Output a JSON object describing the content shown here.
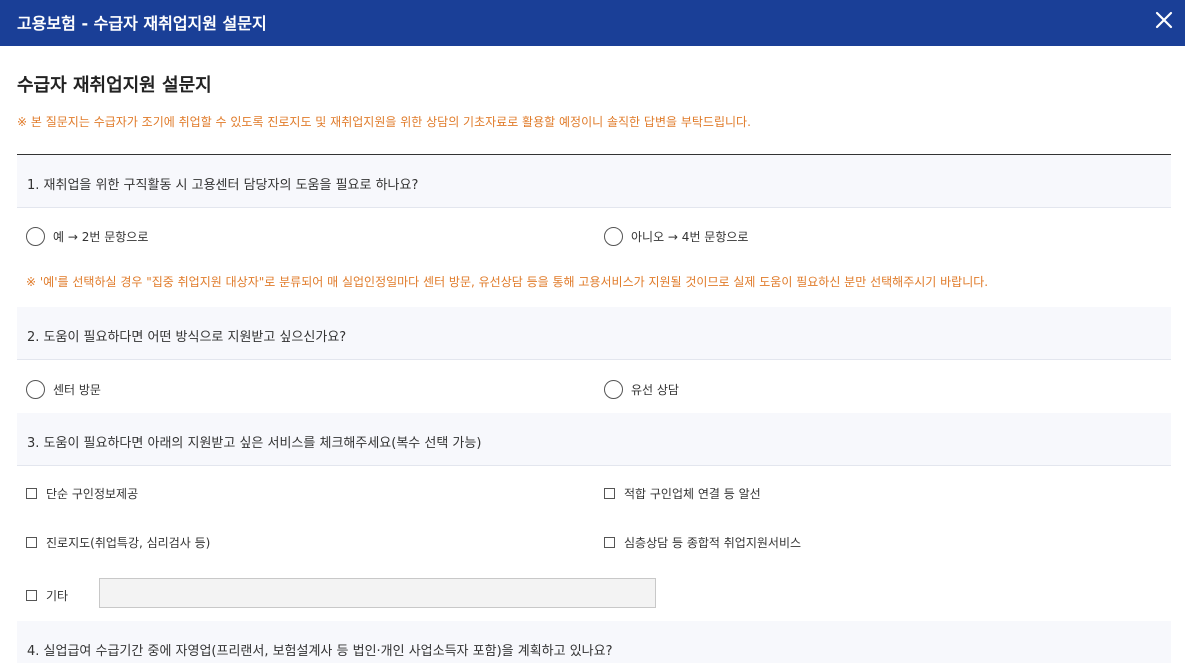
{
  "window": {
    "title": "고용보험 - 수급자 재취업지원 설문지",
    "close_icon": "close-icon"
  },
  "page": {
    "title": "수급자 재취업지원 설문지",
    "notice": "※ 본 질문지는 수급자가 조기에 취업할 수 있도록 진로지도 및 재취업지원을 위한 상담의 기초자료로 활용할 예정이니 솔직한 답변을 부탁드립니다."
  },
  "colors": {
    "header_bg": "#1a3f97",
    "notice_text": "#e07b2a",
    "question_bg": "#f7f8fc"
  },
  "questions": [
    {
      "text": "1. 재취업을 위한 구직활동 시 고용센터 담당자의 도움을 필요로 하나요?",
      "options": [
        "예 → 2번 문항으로",
        "아니오 → 4번 문항으로"
      ],
      "note": "※ '예'를 선택하실 경우 \"집중 취업지원 대상자\"로 분류되어 매 실업인정일마다 센터 방문, 유선상담 등을 통해 고용서비스가 지원될 것이므로 실제 도움이 필요하신 분만 선택해주시기 바랍니다."
    },
    {
      "text": "2. 도움이 필요하다면 어떤 방식으로 지원받고 싶으신가요?",
      "options": [
        "센터 방문",
        "유선 상담"
      ]
    },
    {
      "text": "3. 도움이 필요하다면 아래의 지원받고 싶은 서비스를 체크해주세요(복수 선택 가능)",
      "options": [
        "단순 구인정보제공",
        "적합 구인업체 연결 등 알선",
        "진로지도(취업특강, 심리검사 등)",
        "심층상담 등 종합적 취업지원서비스",
        "기타"
      ],
      "other_value": ""
    },
    {
      "text": "4. 실업급여 수급기간 중에 자영업(프리랜서, 보험설계사 등 법인·개인 사업소득자 포함)을 계획하고 있나요?"
    }
  ]
}
